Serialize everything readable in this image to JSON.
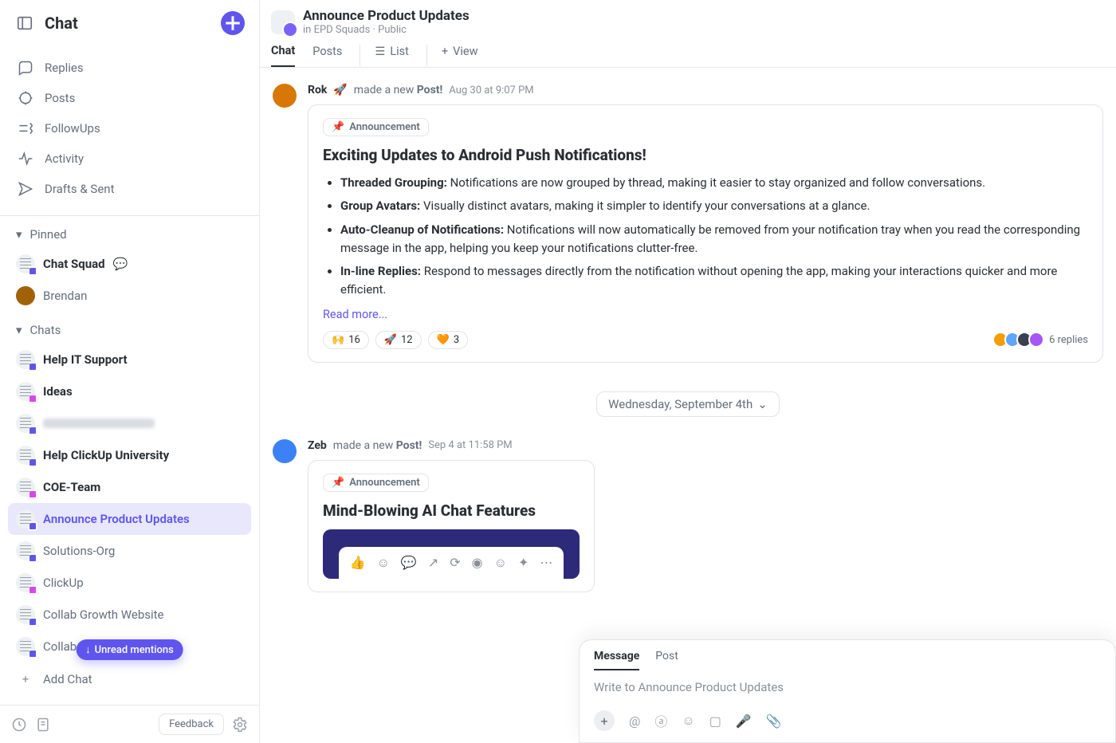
{
  "app_title": "Chat",
  "nav": {
    "replies": "Replies",
    "posts": "Posts",
    "followups": "FollowUps",
    "activity": "Activity",
    "drafts": "Drafts & Sent"
  },
  "sections": {
    "pinned": "Pinned",
    "chats": "Chats"
  },
  "pinned": [
    {
      "label": "Chat Squad"
    },
    {
      "label": "Brendan"
    }
  ],
  "chats": [
    {
      "label": "Help IT Support",
      "bold": true
    },
    {
      "label": "Ideas",
      "bold": true
    },
    {
      "label": "",
      "bold": true
    },
    {
      "label": "Help ClickUp University",
      "bold": true
    },
    {
      "label": "COE-Team",
      "bold": true
    },
    {
      "label": "Announce Product Updates",
      "active": true
    },
    {
      "label": "Solutions-Org"
    },
    {
      "label": "ClickUp"
    },
    {
      "label": "Collab Growth Website"
    },
    {
      "label": "Collab GTM & Product"
    }
  ],
  "add_chat": "Add Chat",
  "unread_pill": "Unread mentions",
  "feedback": "Feedback",
  "header": {
    "title": "Announce Product Updates",
    "breadcrumb_prefix": "in ",
    "breadcrumb": "EPD Squads",
    "vis": "Public"
  },
  "tabs": {
    "chat": "Chat",
    "posts": "Posts",
    "list": "List",
    "view": "View"
  },
  "post1": {
    "name": "Rok",
    "emoji": "🚀",
    "action": "made a new",
    "action_b": "Post!",
    "time": "Aug 30 at 9:07 PM",
    "tag": "Announcement",
    "title": "Exciting Updates to Android Push Notifications!",
    "b1": "Threaded Grouping:",
    "t1": " Notifications are now grouped by thread, making it easier to stay organized and follow conversations.",
    "b2": "Group Avatars:",
    "t2": " Visually distinct avatars, making it simpler to identify your conversations at a glance.",
    "b3": "Auto-Cleanup of Notifications:",
    "t3": " Notifications will now automatically be removed from your notification tray when you read the corresponding message in the app, helping you keep your notifications clutter-free.",
    "b4": "In-line Replies:",
    "t4": " Respond to messages directly from the notification without opening the app, making your interactions quicker and more efficient.",
    "readmore": "Read more...",
    "r1_e": "🙌",
    "r1_c": "16",
    "r2_e": "🚀",
    "r2_c": "12",
    "r3_e": "🧡",
    "r3_c": "3",
    "replies": "6 replies"
  },
  "date_sep": "Wednesday, September 4th",
  "post2": {
    "name": "Zeb",
    "action": "made a new",
    "action_b": "Post!",
    "time": "Sep 4 at 11:58 PM",
    "tag": "Announcement",
    "title": "Mind-Blowing AI Chat Features"
  },
  "composer": {
    "tab_msg": "Message",
    "tab_post": "Post",
    "placeholder": "Write to Announce Product Updates"
  }
}
